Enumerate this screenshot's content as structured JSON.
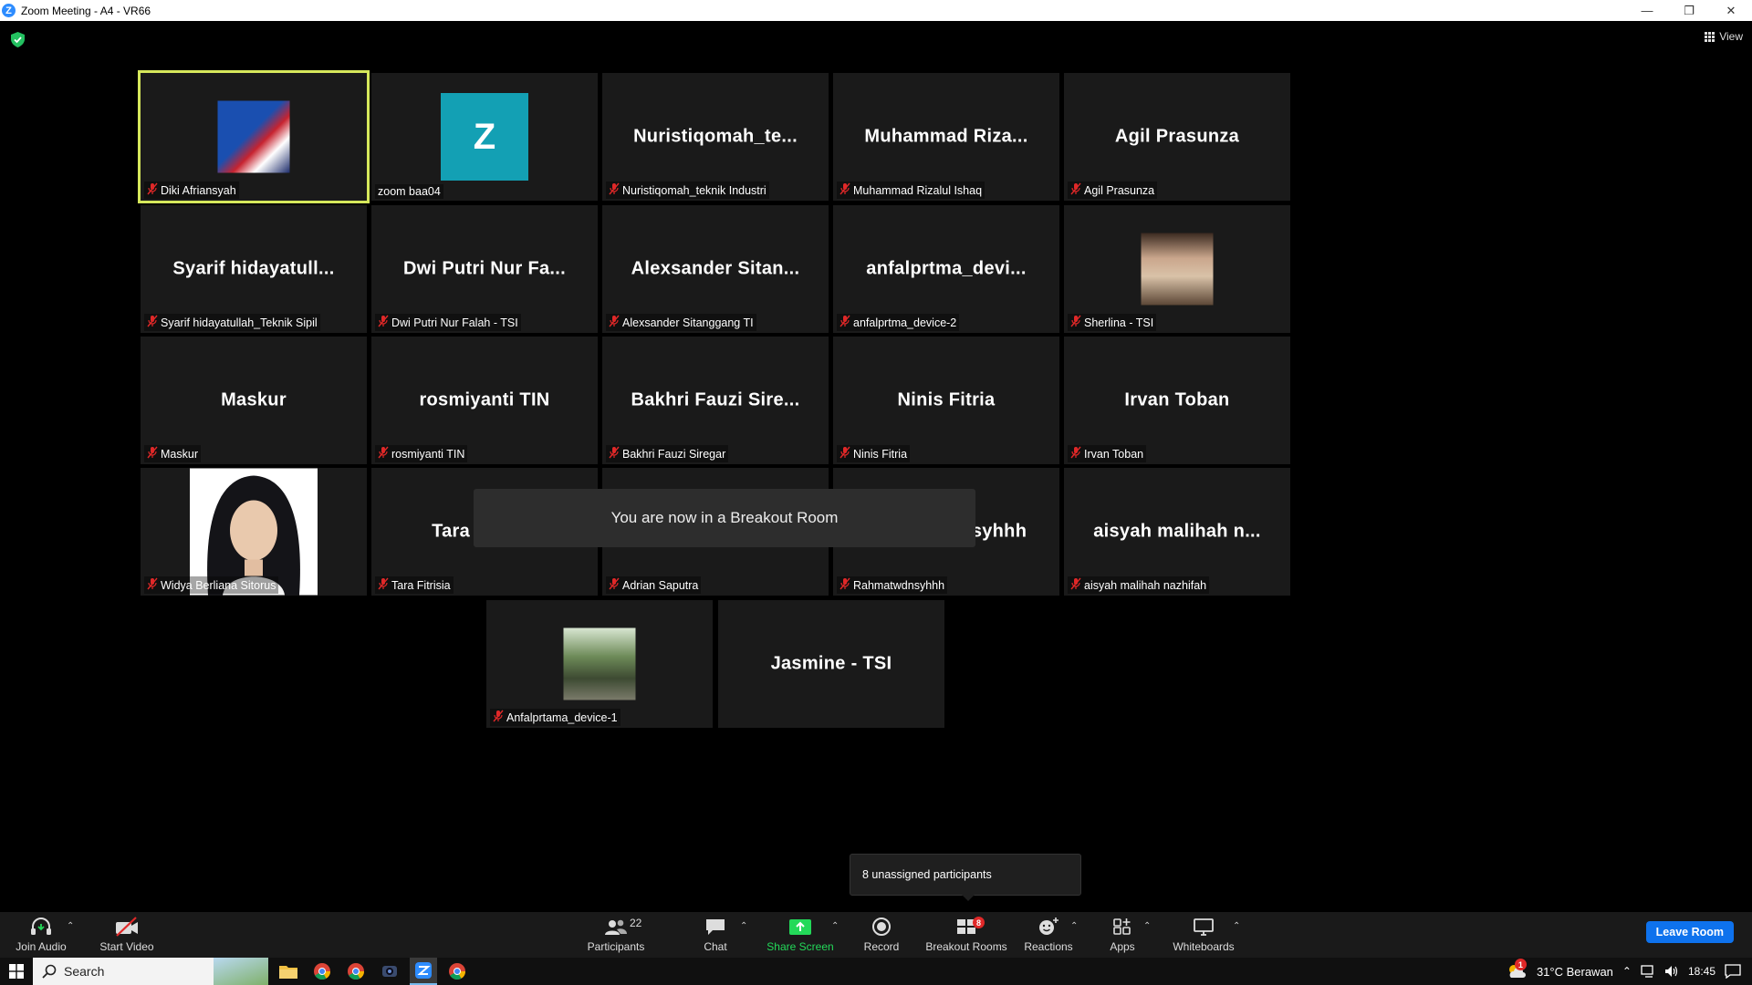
{
  "window": {
    "title": "Zoom Meeting - A4 - VR66"
  },
  "view": {
    "label": "View"
  },
  "tiles": [
    {
      "big": "",
      "name": "Diki Afriansyah",
      "avatar": "photo"
    },
    {
      "big": "Z",
      "name": "zoom baa04",
      "avatar": "letter"
    },
    {
      "big": "Nuristiqomah_te...",
      "name": "Nuristiqomah_teknik Industri"
    },
    {
      "big": "Muhammad  Riza...",
      "name": "Muhammad Rizalul Ishaq"
    },
    {
      "big": "Agil Prasunza",
      "name": "Agil Prasunza"
    },
    {
      "big": "Syarif  hidayatull...",
      "name": "Syarif hidayatullah_Teknik Sipil"
    },
    {
      "big": "Dwi Putri Nur Fa...",
      "name": "Dwi Putri Nur Falah - TSI"
    },
    {
      "big": "Alexsander  Sitan...",
      "name": "Alexsander Sitanggang TI"
    },
    {
      "big": "anfalprtma_devi...",
      "name": "anfalprtma_device-2"
    },
    {
      "big": "",
      "name": "Sherlina - TSI",
      "avatar": "photo"
    },
    {
      "big": "Maskur",
      "name": "Maskur"
    },
    {
      "big": "rosmiyanti TIN",
      "name": "rosmiyanti TIN"
    },
    {
      "big": "Bakhri  Fauzi Sire...",
      "name": "Bakhri Fauzi Siregar"
    },
    {
      "big": "Ninis Fitria",
      "name": "Ninis Fitria"
    },
    {
      "big": "Irvan Toban",
      "name": "Irvan Toban"
    },
    {
      "big": "",
      "name": "Widya Berliana Sitorus",
      "avatar": "photo"
    },
    {
      "big": "Tara Fitrisia",
      "name": "Tara Fitrisia"
    },
    {
      "big": "Adrian Saputra",
      "name": "Adrian Saputra"
    },
    {
      "big": "Rahmatwdnsyhhh",
      "name": "Rahmatwdnsyhhh"
    },
    {
      "big": "aisyah  malihah  n...",
      "name": "aisyah malihah nazhifah"
    },
    {
      "big": "",
      "name": "Anfalprtama_device-1",
      "avatar": "photo"
    },
    {
      "big": "Jasmine - TSI",
      "name": ""
    }
  ],
  "toast": "You are now in a Breakout Room",
  "tooltip": "8 unassigned participants",
  "toolbar": {
    "join_audio": "Join Audio",
    "start_video": "Start Video",
    "participants": "Participants",
    "participants_count": "22",
    "chat": "Chat",
    "share_screen": "Share Screen",
    "record": "Record",
    "breakout_rooms": "Breakout Rooms",
    "breakout_badge": "8",
    "reactions": "Reactions",
    "apps": "Apps",
    "whiteboards": "Whiteboards",
    "leave": "Leave Room"
  },
  "taskbar": {
    "search": "Search",
    "weather": "31°C  Berawan",
    "weather_badge": "1",
    "time": "18:45"
  },
  "colors": {
    "active_speaker": "#d6e85b",
    "share": "#23d959",
    "leave": "#0e72ed",
    "zoom_blue": "#2d8cff"
  }
}
